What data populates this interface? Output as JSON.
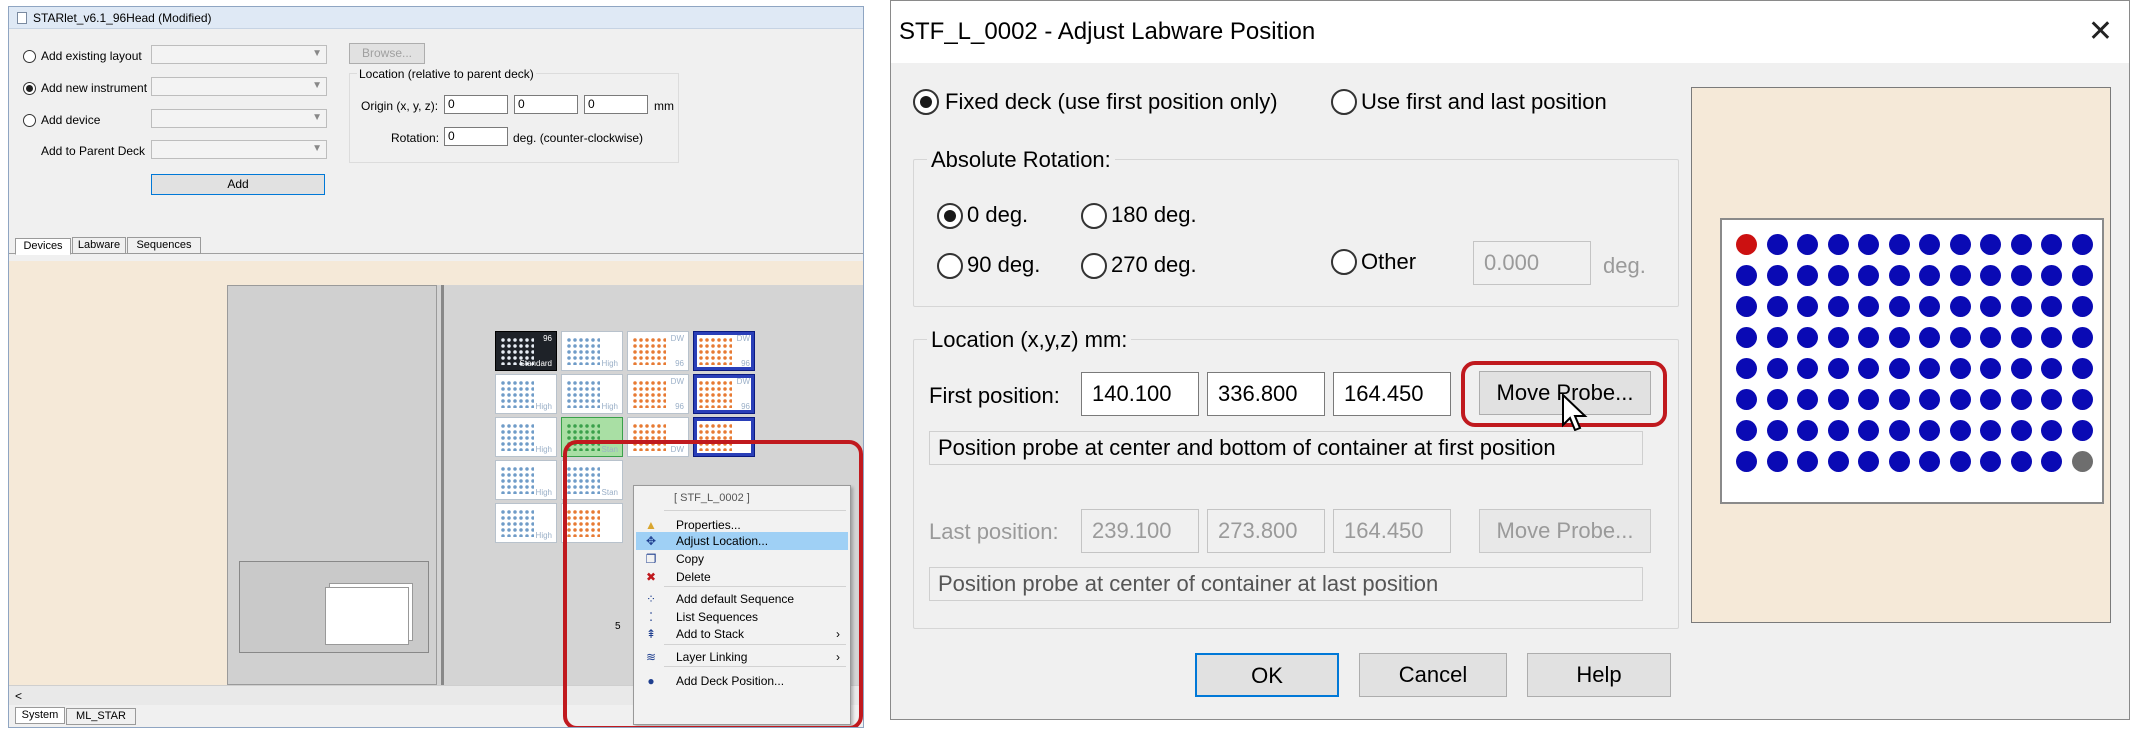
{
  "left": {
    "title": "STARlet_v6.1_96Head (Modified)",
    "options": {
      "add_existing_layout": "Add existing layout",
      "add_new_instrument": "Add new instrument",
      "add_device": "Add device",
      "add_to_parent_deck": "Add to Parent Deck"
    },
    "browse": "Browse...",
    "location_group": "Location (relative to parent deck)",
    "origin_label": "Origin (x, y, z):",
    "origin": {
      "x": "0",
      "y": "0",
      "z": "0"
    },
    "unit_mm": "mm",
    "rotation_label": "Rotation:",
    "rotation": "0",
    "rotation_unit": "deg. (counter-clockwise)",
    "add_button": "Add",
    "tabs": [
      "Devices",
      "Labware",
      "Sequences"
    ],
    "bottom_tabs": [
      "System",
      "ML_STAR"
    ],
    "plates": [
      {
        "row": 0,
        "col": 0,
        "type": "dark",
        "label_top": "96",
        "label": "Standard"
      },
      {
        "row": 0,
        "col": 1,
        "type": "blue",
        "label": "High"
      },
      {
        "row": 0,
        "col": 2,
        "type": "orange",
        "label": "96",
        "label_top": "DW"
      },
      {
        "row": 0,
        "col": 3,
        "type": "orange",
        "label": "96",
        "label_top": "DW"
      },
      {
        "row": 1,
        "col": 0,
        "type": "blue",
        "label": "High"
      },
      {
        "row": 1,
        "col": 1,
        "type": "blue",
        "label": "High"
      },
      {
        "row": 1,
        "col": 2,
        "type": "orange",
        "label": "96",
        "label_top": "DW"
      },
      {
        "row": 1,
        "col": 3,
        "type": "orange",
        "label": "96",
        "label_top": "DW"
      },
      {
        "row": 2,
        "col": 0,
        "type": "blue",
        "label": "High"
      },
      {
        "row": 2,
        "col": 1,
        "type": "green",
        "label": "Stan"
      },
      {
        "row": 2,
        "col": 2,
        "type": "orange",
        "label": "DW"
      },
      {
        "row": 2,
        "col": 3,
        "type": "orange",
        "label": ""
      },
      {
        "row": 3,
        "col": 0,
        "type": "blue",
        "label": "High"
      },
      {
        "row": 3,
        "col": 1,
        "type": "blue",
        "label": "Stan"
      },
      {
        "row": 4,
        "col": 0,
        "type": "blue",
        "label": "High"
      },
      {
        "row": 4,
        "col": 1,
        "type": "orange",
        "label": ""
      }
    ],
    "position_number": "5",
    "context_menu": {
      "header": "[ STF_L_0002 ]",
      "items": [
        {
          "label": "Properties...",
          "icon": "properties-icon",
          "highlighted": false,
          "submenu": false
        },
        {
          "label": "Adjust Location...",
          "icon": "move-icon",
          "highlighted": true,
          "submenu": false
        },
        {
          "label": "Copy",
          "icon": "copy-icon",
          "highlighted": false,
          "submenu": false
        },
        {
          "label": "Delete",
          "icon": "delete-icon",
          "highlighted": false,
          "submenu": false
        },
        {
          "label": "Add default Sequence",
          "icon": "sequence-icon",
          "highlighted": false,
          "submenu": false
        },
        {
          "label": "List Sequences",
          "icon": "list-icon",
          "highlighted": false,
          "submenu": false
        },
        {
          "label": "Add to Stack",
          "icon": "stack-icon",
          "highlighted": false,
          "submenu": true
        },
        {
          "label": "Layer Linking",
          "icon": "link-icon",
          "highlighted": false,
          "submenu": true
        },
        {
          "label": "Add Deck Position...",
          "icon": "dot-icon",
          "highlighted": false,
          "submenu": false
        }
      ]
    },
    "scroll_left": "<"
  },
  "dialog": {
    "title": "STF_L_0002 - Adjust Labware Position",
    "close": "✕",
    "mode_fixed": "Fixed deck (use first position only)",
    "mode_first_last": "Use first and last position",
    "rotation_group": "Absolute Rotation:",
    "rot_0": "0 deg.",
    "rot_180": "180 deg.",
    "rot_90": "90 deg.",
    "rot_270": "270 deg.",
    "rot_other": "Other",
    "rot_other_value": "0.000",
    "rot_other_unit": "deg.",
    "location_group": "Location (x,y,z) mm:",
    "first_label": "First position:",
    "first": {
      "x": "140.100",
      "y": "336.800",
      "z": "164.450"
    },
    "move_probe": "Move Probe...",
    "first_msg": "Position probe at center and bottom of container at first position",
    "last_label": "Last position:",
    "last": {
      "x": "239.100",
      "y": "273.800",
      "z": "164.450"
    },
    "last_msg": "Position probe at center of container at last position",
    "ok": "OK",
    "cancel": "Cancel",
    "help": "Help",
    "plate_preview": {
      "rows": 8,
      "cols": 12,
      "first_well_color": "#cc1111",
      "last_well_color": "#6e6e6e",
      "well_color": "#0a0ab4"
    }
  },
  "colors": {
    "highlight_red": "#c0191e",
    "menu_highlight": "#9fd0f5",
    "deck_bg": "#f5e9d8"
  }
}
